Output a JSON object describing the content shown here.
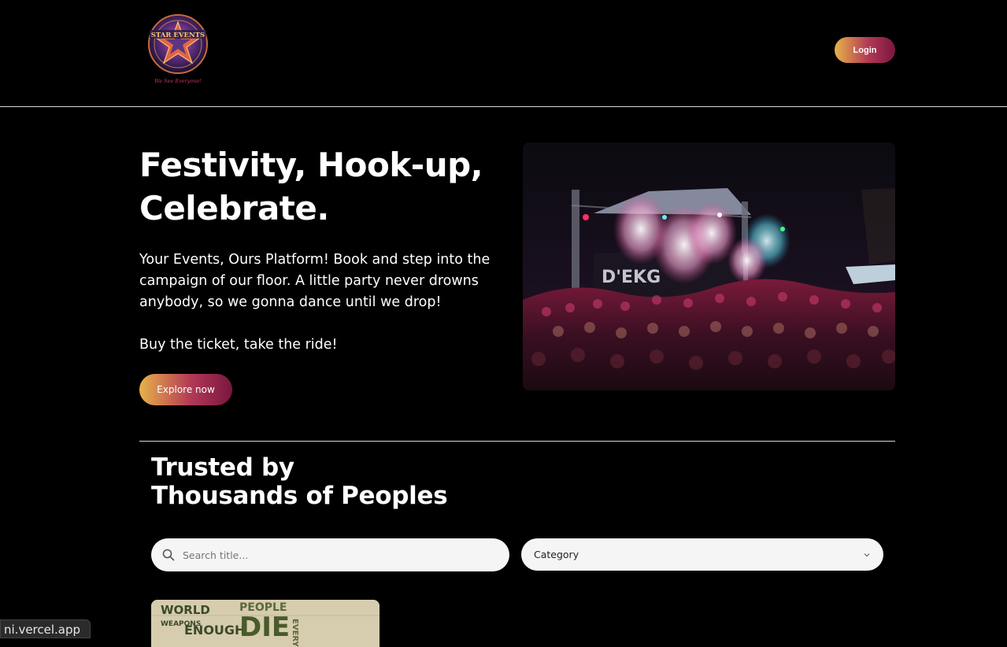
{
  "header": {
    "logo_text": "STAR EVENTS",
    "logo_tagline": "We See Everyone!",
    "login_label": "Login"
  },
  "hero": {
    "title_line1": "Festivity, Hook-up,",
    "title_line2": "Celebrate.",
    "description": "Your Events, Ours Platform! Book and step into the campaign of our floor. A little party never drowns anybody, so we gonna dance until we drop!",
    "subtext": "Buy the ticket, take the ride!",
    "explore_label": "Explore now",
    "image_sign": "D'EKG"
  },
  "trusted": {
    "line1": "Trusted by",
    "line2": "Thousands of Peoples"
  },
  "filters": {
    "search_placeholder": "Search title...",
    "category_label": "Category"
  },
  "event_card": {
    "poster_text_1": "WORLD",
    "poster_text_2": "WEAPONS",
    "poster_text_3": "ENOUGH",
    "poster_text_4": "PEOPLE",
    "poster_text_5": "DIE",
    "poster_text_6": "EVERY"
  },
  "status_bar": {
    "url_text": "ni.vercel.app"
  }
}
